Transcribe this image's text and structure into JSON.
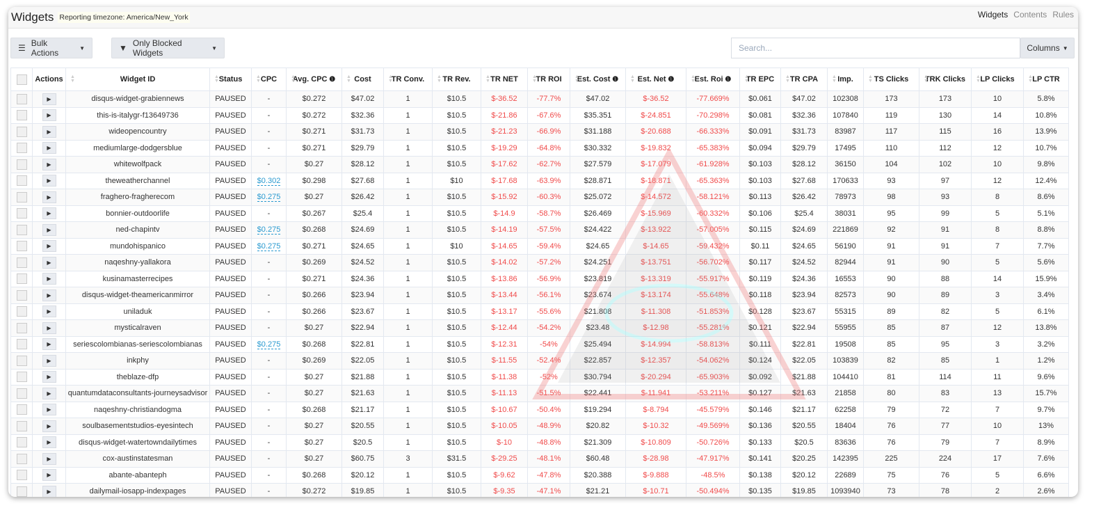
{
  "header": {
    "title": "Widgets",
    "timezone": "Reporting timezone: America/New_York",
    "nav": [
      "Widgets",
      "Contents",
      "Rules"
    ]
  },
  "toolbar": {
    "bulk_actions": "Bulk Actions",
    "filter": "Only Blocked Widgets",
    "search_placeholder": "Search...",
    "columns": "Columns"
  },
  "colors": {
    "negative": "#f04b4b",
    "link": "#2a9ad0"
  },
  "columns": [
    "Actions",
    "Widget ID",
    "Status",
    "CPC",
    "Avg. CPC",
    "Cost",
    "TR Conv.",
    "TR Rev.",
    "TR NET",
    "TR ROI",
    "Est. Cost",
    "Est. Net",
    "Est. Roi",
    "TR EPC",
    "TR CPA",
    "Imp.",
    "TS Clicks",
    "TRK Clicks",
    "LP Clicks",
    "LP CTR"
  ],
  "rows": [
    [
      "disqus-widget-grabiennews",
      "PAUSED",
      "-",
      "$0.272",
      "$47.02",
      "1",
      "$10.5",
      "$-36.52",
      "-77.7%",
      "$47.02",
      "$-36.52",
      "-77.669%",
      "$0.061",
      "$47.02",
      "102308",
      "173",
      "173",
      "10",
      "5.8%"
    ],
    [
      "this-is-italygr-f13649736",
      "PAUSED",
      "-",
      "$0.272",
      "$32.36",
      "1",
      "$10.5",
      "$-21.86",
      "-67.6%",
      "$35.351",
      "$-24.851",
      "-70.298%",
      "$0.081",
      "$32.36",
      "107840",
      "119",
      "130",
      "14",
      "10.8%"
    ],
    [
      "wideopencountry",
      "PAUSED",
      "-",
      "$0.271",
      "$31.73",
      "1",
      "$10.5",
      "$-21.23",
      "-66.9%",
      "$31.188",
      "$-20.688",
      "-66.333%",
      "$0.091",
      "$31.73",
      "83987",
      "117",
      "115",
      "16",
      "13.9%"
    ],
    [
      "mediumlarge-dodgersblue",
      "PAUSED",
      "-",
      "$0.271",
      "$29.79",
      "1",
      "$10.5",
      "$-19.29",
      "-64.8%",
      "$30.332",
      "$-19.832",
      "-65.383%",
      "$0.094",
      "$29.79",
      "17495",
      "110",
      "112",
      "12",
      "10.7%"
    ],
    [
      "whitewolfpack",
      "PAUSED",
      "-",
      "$0.27",
      "$28.12",
      "1",
      "$10.5",
      "$-17.62",
      "-62.7%",
      "$27.579",
      "$-17.079",
      "-61.928%",
      "$0.103",
      "$28.12",
      "36150",
      "104",
      "102",
      "10",
      "9.8%"
    ],
    [
      "theweatherchannel",
      "PAUSED",
      "$0.302",
      "$0.298",
      "$27.68",
      "1",
      "$10",
      "$-17.68",
      "-63.9%",
      "$28.871",
      "$-18.871",
      "-65.363%",
      "$0.103",
      "$27.68",
      "170633",
      "93",
      "97",
      "12",
      "12.4%"
    ],
    [
      "fraghero-fragherecom",
      "PAUSED",
      "$0.275",
      "$0.27",
      "$26.42",
      "1",
      "$10.5",
      "$-15.92",
      "-60.3%",
      "$25.072",
      "$-14.572",
      "-58.121%",
      "$0.113",
      "$26.42",
      "78973",
      "98",
      "93",
      "8",
      "8.6%"
    ],
    [
      "bonnier-outdoorlife",
      "PAUSED",
      "-",
      "$0.267",
      "$25.4",
      "1",
      "$10.5",
      "$-14.9",
      "-58.7%",
      "$26.469",
      "$-15.969",
      "-60.332%",
      "$0.106",
      "$25.4",
      "38031",
      "95",
      "99",
      "5",
      "5.1%"
    ],
    [
      "ned-chapintv",
      "PAUSED",
      "$0.275",
      "$0.268",
      "$24.69",
      "1",
      "$10.5",
      "$-14.19",
      "-57.5%",
      "$24.422",
      "$-13.922",
      "-57.005%",
      "$0.115",
      "$24.69",
      "221869",
      "92",
      "91",
      "8",
      "8.8%"
    ],
    [
      "mundohispanico",
      "PAUSED",
      "$0.275",
      "$0.271",
      "$24.65",
      "1",
      "$10",
      "$-14.65",
      "-59.4%",
      "$24.65",
      "$-14.65",
      "-59.432%",
      "$0.11",
      "$24.65",
      "56190",
      "91",
      "91",
      "7",
      "7.7%"
    ],
    [
      "naqeshny-yallakora",
      "PAUSED",
      "-",
      "$0.269",
      "$24.52",
      "1",
      "$10.5",
      "$-14.02",
      "-57.2%",
      "$24.251",
      "$-13.751",
      "-56.702%",
      "$0.117",
      "$24.52",
      "82944",
      "91",
      "90",
      "5",
      "5.6%"
    ],
    [
      "kusinamasterrecipes",
      "PAUSED",
      "-",
      "$0.271",
      "$24.36",
      "1",
      "$10.5",
      "$-13.86",
      "-56.9%",
      "$23.819",
      "$-13.319",
      "-55.917%",
      "$0.119",
      "$24.36",
      "16553",
      "90",
      "88",
      "14",
      "15.9%"
    ],
    [
      "disqus-widget-theamericanmirror",
      "PAUSED",
      "-",
      "$0.266",
      "$23.94",
      "1",
      "$10.5",
      "$-13.44",
      "-56.1%",
      "$23.674",
      "$-13.174",
      "-55.648%",
      "$0.118",
      "$23.94",
      "82573",
      "90",
      "89",
      "3",
      "3.4%"
    ],
    [
      "uniladuk",
      "PAUSED",
      "-",
      "$0.266",
      "$23.67",
      "1",
      "$10.5",
      "$-13.17",
      "-55.6%",
      "$21.808",
      "$-11.308",
      "-51.853%",
      "$0.128",
      "$23.67",
      "55315",
      "89",
      "82",
      "5",
      "6.1%"
    ],
    [
      "mysticalraven",
      "PAUSED",
      "-",
      "$0.27",
      "$22.94",
      "1",
      "$10.5",
      "$-12.44",
      "-54.2%",
      "$23.48",
      "$-12.98",
      "-55.281%",
      "$0.121",
      "$22.94",
      "55955",
      "85",
      "87",
      "12",
      "13.8%"
    ],
    [
      "seriescolombianas-seriescolombianas",
      "PAUSED",
      "$0.275",
      "$0.268",
      "$22.81",
      "1",
      "$10.5",
      "$-12.31",
      "-54%",
      "$25.494",
      "$-14.994",
      "-58.813%",
      "$0.111",
      "$22.81",
      "19508",
      "85",
      "95",
      "3",
      "3.2%"
    ],
    [
      "inkphy",
      "PAUSED",
      "-",
      "$0.269",
      "$22.05",
      "1",
      "$10.5",
      "$-11.55",
      "-52.4%",
      "$22.857",
      "$-12.357",
      "-54.062%",
      "$0.124",
      "$22.05",
      "103839",
      "82",
      "85",
      "1",
      "1.2%"
    ],
    [
      "theblaze-dfp",
      "PAUSED",
      "-",
      "$0.27",
      "$21.88",
      "1",
      "$10.5",
      "$-11.38",
      "-52%",
      "$30.794",
      "$-20.294",
      "-65.903%",
      "$0.092",
      "$21.88",
      "104410",
      "81",
      "114",
      "11",
      "9.6%"
    ],
    [
      "quantumdataconsultants-journeysadvisor",
      "PAUSED",
      "-",
      "$0.27",
      "$21.63",
      "1",
      "$10.5",
      "$-11.13",
      "-51.5%",
      "$22.441",
      "$-11.941",
      "-53.211%",
      "$0.127",
      "$21.63",
      "21858",
      "80",
      "83",
      "13",
      "15.7%"
    ],
    [
      "naqeshny-christiandogma",
      "PAUSED",
      "-",
      "$0.268",
      "$21.17",
      "1",
      "$10.5",
      "$-10.67",
      "-50.4%",
      "$19.294",
      "$-8.794",
      "-45.579%",
      "$0.146",
      "$21.17",
      "62258",
      "79",
      "72",
      "7",
      "9.7%"
    ],
    [
      "soulbasementstudios-eyesintech",
      "PAUSED",
      "-",
      "$0.27",
      "$20.55",
      "1",
      "$10.5",
      "$-10.05",
      "-48.9%",
      "$20.82",
      "$-10.32",
      "-49.569%",
      "$0.136",
      "$20.55",
      "18404",
      "76",
      "77",
      "10",
      "13%"
    ],
    [
      "disqus-widget-watertowndailytimes",
      "PAUSED",
      "-",
      "$0.27",
      "$20.5",
      "1",
      "$10.5",
      "$-10",
      "-48.8%",
      "$21.309",
      "$-10.809",
      "-50.726%",
      "$0.133",
      "$20.5",
      "83636",
      "76",
      "79",
      "7",
      "8.9%"
    ],
    [
      "cox-austinstatesman",
      "PAUSED",
      "-",
      "$0.27",
      "$60.75",
      "3",
      "$31.5",
      "$-29.25",
      "-48.1%",
      "$60.48",
      "$-28.98",
      "-47.917%",
      "$0.141",
      "$20.25",
      "142395",
      "225",
      "224",
      "17",
      "7.6%"
    ],
    [
      "abante-abanteph",
      "PAUSED",
      "-",
      "$0.268",
      "$20.12",
      "1",
      "$10.5",
      "$-9.62",
      "-47.8%",
      "$20.388",
      "$-9.888",
      "-48.5%",
      "$0.138",
      "$20.12",
      "22689",
      "75",
      "76",
      "5",
      "6.6%"
    ],
    [
      "dailymail-iosapp-indexpages",
      "PAUSED",
      "-",
      "$0.272",
      "$19.85",
      "1",
      "$10.5",
      "$-9.35",
      "-47.1%",
      "$21.21",
      "$-10.71",
      "-50.494%",
      "$0.135",
      "$19.85",
      "1093940",
      "73",
      "78",
      "2",
      "2.6%"
    ]
  ]
}
